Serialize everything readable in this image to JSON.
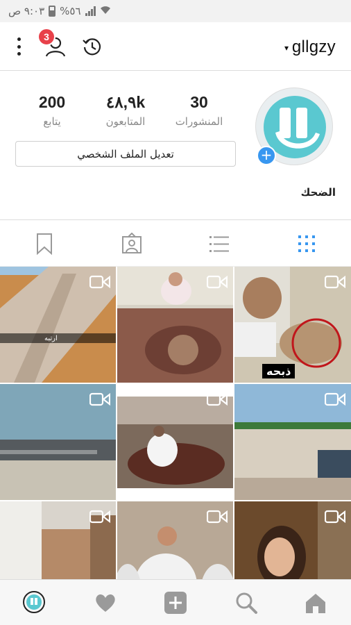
{
  "status_bar": {
    "time": "٩:٠٣ ص",
    "battery": "%٥٦"
  },
  "header": {
    "username": "gllgzy",
    "notification_count": "3"
  },
  "profile": {
    "stats": [
      {
        "key": "posts",
        "value": "30",
        "label": "المنشورات"
      },
      {
        "key": "followers",
        "value": "٤٨,٩k",
        "label": "المتابعون"
      },
      {
        "key": "following",
        "value": "200",
        "label": "يتابع"
      }
    ],
    "edit_button": "تعديل الملف الشخصي",
    "bio_name": "الضحك"
  },
  "posts": [
    {
      "id": 1,
      "kind": "video",
      "caption": "ذبحه"
    },
    {
      "id": 2,
      "kind": "video"
    },
    {
      "id": 3,
      "kind": "video",
      "caption": "ارتبه"
    },
    {
      "id": 4,
      "kind": "video"
    },
    {
      "id": 5,
      "kind": "video"
    },
    {
      "id": 6,
      "kind": "video"
    },
    {
      "id": 7,
      "kind": "video"
    },
    {
      "id": 8,
      "kind": "video"
    },
    {
      "id": 9,
      "kind": "video"
    }
  ],
  "accent": {
    "badge": "#e8414a",
    "active_tab": "#3897f0",
    "avatar_teal": "#5ac8d0"
  }
}
